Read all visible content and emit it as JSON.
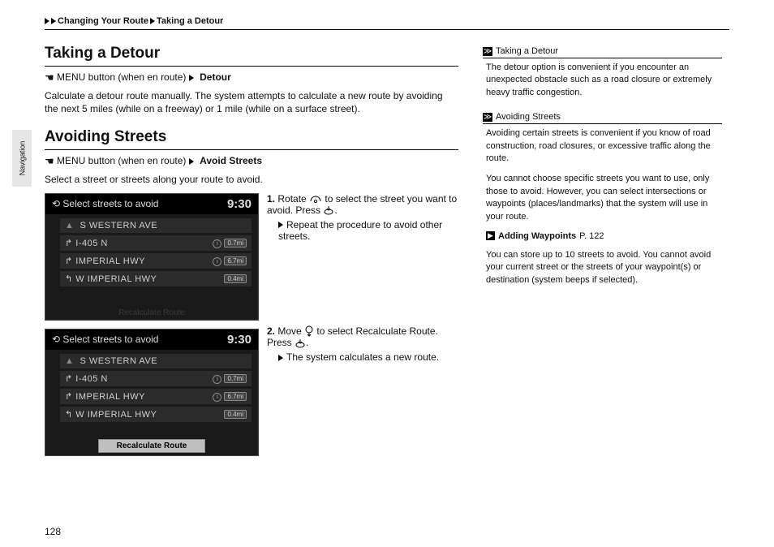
{
  "breadcrumb": {
    "seg1": "Changing Your Route",
    "seg2": "Taking a Detour"
  },
  "sideTab": "Navigation",
  "pageNumber": "128",
  "section1": {
    "title": "Taking a Detour",
    "menuPrefix": "MENU button (when en route)",
    "menuAction": "Detour",
    "body": "Calculate a detour route manually. The system attempts to calculate a new route by avoiding the next 5 miles (while on a freeway) or 1 mile (while on a surface street)."
  },
  "section2": {
    "title": "Avoiding Streets",
    "menuPrefix": "MENU button (when en route)",
    "menuAction": "Avoid Streets",
    "body": "Select a street or streets along your route to avoid.",
    "step1_prefix": "1.",
    "step1_a": "Rotate",
    "step1_b": "to select the street you want to avoid. Press",
    "step1_end": ".",
    "step1_sub": "Repeat the procedure to avoid other streets.",
    "step2_prefix": "2.",
    "step2_a": "Move",
    "step2_b": "to select",
    "step2_bold": "Recalculate Route",
    "step2_c": ". Press",
    "step2_end": ".",
    "step2_sub": "The system calculates a new route."
  },
  "screenshot": {
    "title": "Select streets to avoid",
    "time": "9:30",
    "rows": [
      {
        "name": "S WESTERN AVE",
        "dist": ""
      },
      {
        "name": "I-405 N",
        "dist": "0.7mi"
      },
      {
        "name": "IMPERIAL HWY",
        "dist": "6.7mi"
      },
      {
        "name": "W IMPERIAL HWY",
        "dist": "0.4mi"
      }
    ],
    "footer": "Recalculate Route"
  },
  "sidebar": {
    "h1": "Taking a Detour",
    "p1": "The detour option is convenient if you encounter an unexpected obstacle such as a road closure or extremely heavy traffic congestion.",
    "h2": "Avoiding Streets",
    "p2": "Avoiding certain streets is convenient if you know of road construction, road closures, or excessive traffic along the route.",
    "p3": "You cannot choose specific streets you want to use, only those to avoid. However, you can select intersections or waypoints (places/landmarks) that the system will use in your route.",
    "xref_label": "Adding Waypoints",
    "xref_page": "P. 122",
    "p4": "You can store up to 10 streets to avoid. You cannot avoid your current street or the streets of your waypoint(s) or destination (system beeps if selected)."
  }
}
